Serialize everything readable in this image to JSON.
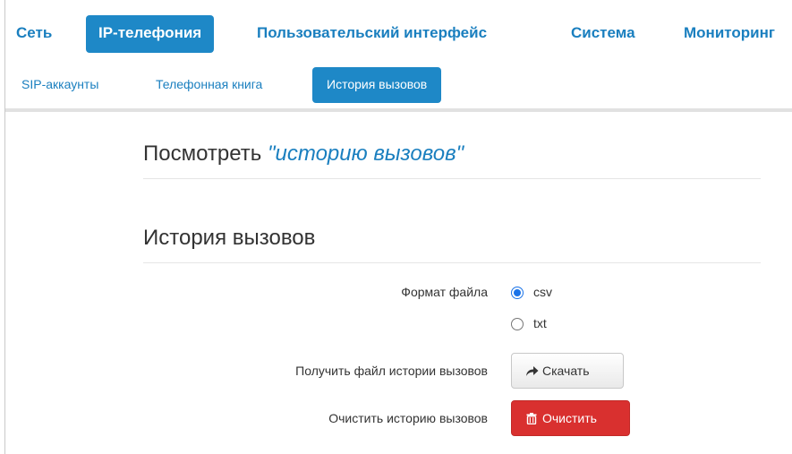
{
  "top_nav": {
    "tabs": [
      {
        "label": "Сеть",
        "active": false
      },
      {
        "label": "IP-телефония",
        "active": true
      },
      {
        "label": "Пользовательский интерфейс",
        "active": false
      },
      {
        "label": "Система",
        "active": false
      },
      {
        "label": "Мониторинг",
        "active": false
      }
    ]
  },
  "sub_nav": {
    "tabs": [
      {
        "label": "SIP-аккаунты",
        "active": false
      },
      {
        "label": "Телефонная книга",
        "active": false
      },
      {
        "label": "История вызовов",
        "active": true
      }
    ]
  },
  "view_section": {
    "prefix": "Посмотреть",
    "link": "\"историю вызовов\""
  },
  "history_section": {
    "title": "История вызовов",
    "file_format": {
      "label": "Формат файла",
      "options": [
        {
          "label": "csv",
          "checked": true
        },
        {
          "label": "txt",
          "checked": false
        }
      ]
    },
    "download": {
      "label": "Получить файл истории вызовов",
      "button_label": "Скачать",
      "icon": "share-arrow-icon"
    },
    "clear": {
      "label": "Очистить историю вызовов",
      "button_label": "Очистить",
      "icon": "trash-icon"
    }
  },
  "colors": {
    "accent": "#1e88c7",
    "link": "#1a7fbf",
    "danger": "#d9302f"
  }
}
